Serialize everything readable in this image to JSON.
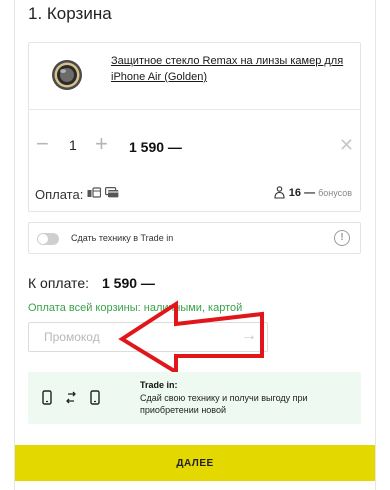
{
  "page": {
    "title": "1. Корзина"
  },
  "cart_item": {
    "name": "Защитное стекло Remax на линзы камер для iPhone Air (Golden)",
    "quantity": "1",
    "minus_icon": "minus-icon",
    "plus_icon": "plus-icon",
    "price": "1 590 —",
    "remove_icon": "close-icon",
    "payment_label": "Оплата:",
    "payment_icons": [
      "cash-icon",
      "card-icon"
    ],
    "bonus_value": "16 —",
    "bonus_label": "бонусов"
  },
  "tradein_toggle": {
    "label": "Сдать технику в Trade in",
    "enabled": false,
    "info_icon": "info-icon"
  },
  "summary": {
    "total_label": "К оплате:",
    "total_value": "1 590 —",
    "payment_methods": "Оплата всей корзины: наличными, картой"
  },
  "promo": {
    "placeholder": "Промокод",
    "submit_icon": "arrow-right-icon"
  },
  "tradein_banner": {
    "icons": [
      "phone-icon",
      "swap-icon",
      "phone-icon"
    ],
    "title": "Trade in:",
    "text": "Сдай свою технику и получи выгоду при приобретении новой"
  },
  "actions": {
    "next_label": "ДАЛЕЕ"
  },
  "colors": {
    "accent": "#e3d900",
    "green": "#3aa14a",
    "annotation_red": "#e0161b",
    "banner_bg": "#eefaf1"
  }
}
